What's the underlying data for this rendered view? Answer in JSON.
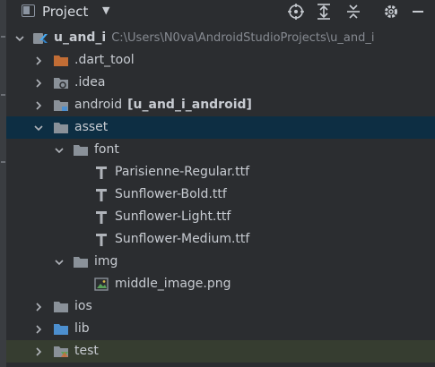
{
  "header": {
    "title": "Project"
  },
  "tree": {
    "root": {
      "label": "u_and_i",
      "path": "C:\\Users\\N0va\\AndroidStudioProjects\\u_and_i"
    },
    "dart_tool": {
      "label": ".dart_tool"
    },
    "idea": {
      "label": ".idea"
    },
    "android": {
      "label": "android",
      "module": "[u_and_i_android]"
    },
    "asset": {
      "label": "asset"
    },
    "font": {
      "label": "font"
    },
    "fonts": [
      {
        "label": "Parisienne-Regular.ttf"
      },
      {
        "label": "Sunflower-Bold.ttf"
      },
      {
        "label": "Sunflower-Light.ttf"
      },
      {
        "label": "Sunflower-Medium.ttf"
      }
    ],
    "img": {
      "label": "img"
    },
    "image_file": {
      "label": "middle_image.png"
    },
    "ios": {
      "label": "ios"
    },
    "lib": {
      "label": "lib"
    },
    "test": {
      "label": "test"
    }
  },
  "colors": {
    "background": "#2b2d30",
    "selected_row": "#0d2e43",
    "folder": "#8a9199",
    "excluded_folder": "#c26d35",
    "source_folder": "#4c8fcf"
  }
}
